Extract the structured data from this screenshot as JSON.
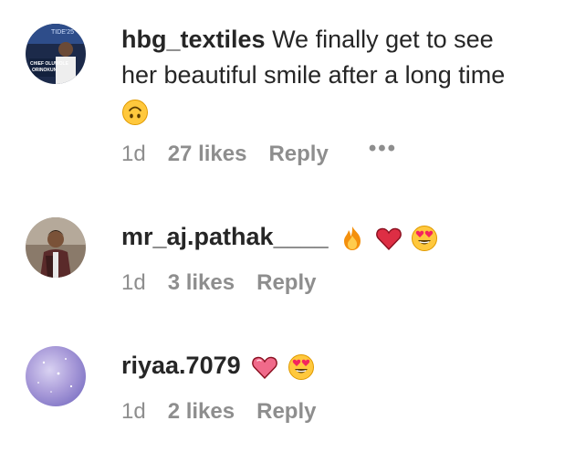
{
  "comments": [
    {
      "username": "hbg_textiles",
      "text_line1": "We finally get to see",
      "text_line2": "her beautiful smile after a long time",
      "emoji": "upside-down-face",
      "avatar_banner_top": "TIDE'25",
      "avatar_caption_line1": "CHIEF OLUWOLE",
      "avatar_caption_line2": "ORINOKUN",
      "time": "1d",
      "likes": "27 likes",
      "reply": "Reply",
      "more": "•••"
    },
    {
      "username": "mr_aj.pathak____",
      "emojis": [
        "fire",
        "red-heart",
        "heart-eyes"
      ],
      "time": "1d",
      "likes": "3 likes",
      "reply": "Reply"
    },
    {
      "username": "riyaa.7079",
      "emojis": [
        "pink-heart",
        "heart-eyes"
      ],
      "time": "1d",
      "likes": "2 likes",
      "reply": "Reply"
    }
  ],
  "colors": {
    "text": "#262626",
    "meta": "#8e8e8e",
    "heart_red": "#e0245e",
    "emoji_yellow": "#ffc83d"
  }
}
